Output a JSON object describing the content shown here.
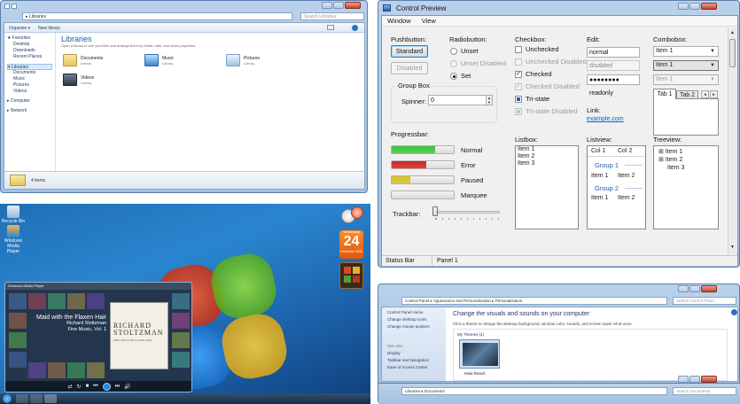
{
  "explorer": {
    "path": "Libraries",
    "search_placeholder": "Search Libraries",
    "toolbar": {
      "organize": "Organize ▾",
      "new_library": "New library"
    },
    "nav": {
      "favorites": "Favorites",
      "favorites_items": [
        "Desktop",
        "Downloads",
        "Recent Places"
      ],
      "libraries": "Libraries",
      "library_items": [
        "Documents",
        "Music",
        "Pictures",
        "Videos"
      ],
      "computer": "Computer",
      "network": "Network"
    },
    "header_title": "Libraries",
    "header_desc": "Open a library to see your files and arrange them by folder, date, and other properties.",
    "libraries": [
      {
        "name": "Documents",
        "type": "Library"
      },
      {
        "name": "Music",
        "type": "Library"
      },
      {
        "name": "Pictures",
        "type": "Library"
      },
      {
        "name": "Videos",
        "type": "Library"
      }
    ],
    "status": "4 items"
  },
  "desktop": {
    "icons": [
      "Recycle Bin",
      "Windows Media Player"
    ],
    "calendar": {
      "weekday": "Wednesday",
      "day": "24",
      "month": "December 2008"
    },
    "media_player": {
      "title": "Windows Media Player",
      "song": "Maid with the Flaxen Hair",
      "artist": "Richard Stoltzman",
      "album": "Fine Music, Vol. 1",
      "cover_title": "RICHARD STOLTZMAN",
      "cover_sub": "MAID WITH THE FLAXEN HAIR"
    }
  },
  "control_preview": {
    "title": "Control Preview",
    "menu": [
      "Window",
      "View"
    ],
    "pushbutton": {
      "label": "Pushbutton:",
      "standard": "Standard",
      "disabled": "Disabled"
    },
    "radiobutton": {
      "label": "Radiobutton:",
      "items": [
        "Unset",
        "Unset Disabled",
        "Set"
      ]
    },
    "checkbox": {
      "label": "Checkbox:",
      "items": [
        "Unchecked",
        "Unchecked Disabled",
        "Checked",
        "Checked Disabled",
        "Tri-state",
        "Tri-state Disabled"
      ]
    },
    "edit": {
      "label": "Edit:",
      "normal": "normal",
      "disabled": "disabled",
      "password": "●●●●●●●●",
      "readonly": "readonly"
    },
    "link": {
      "label": "Link:",
      "text": "example.com"
    },
    "combobox": {
      "label": "Combobox:",
      "items": [
        "Item 1",
        "Item 1",
        "Item 1"
      ]
    },
    "tabs": [
      "Tab 1",
      "Tab 2"
    ],
    "groupbox": {
      "label": "Group Box",
      "spinner_label": "Spinner:",
      "spinner_value": "0"
    },
    "progressbar": {
      "label": "Progressbar:",
      "bars": [
        {
          "name": "Normal",
          "value": 0.7,
          "color": "#3cc23c"
        },
        {
          "name": "Error",
          "value": 0.55,
          "color": "#d42020"
        },
        {
          "name": "Paused",
          "value": 0.3,
          "color": "#d6c21a"
        },
        {
          "name": "Marquee",
          "value": 0.0,
          "color": "#3cc23c"
        }
      ]
    },
    "trackbar": {
      "label": "Trackbar:",
      "value": 0
    },
    "listbox": {
      "label": "Listbox:",
      "items": [
        "Item 1",
        "Item 2",
        "Item 3"
      ]
    },
    "listview": {
      "label": "Listview:",
      "columns": [
        "Col 1",
        "Col 2"
      ],
      "groups": [
        {
          "name": "Group 1",
          "rows": [
            [
              "Item 1",
              "Item 2"
            ]
          ]
        },
        {
          "name": "Group 2",
          "rows": [
            [
              "Item 1",
              "Item 2"
            ]
          ]
        }
      ]
    },
    "treeview": {
      "label": "Treeview:",
      "items": [
        "Item 1",
        "Item 2",
        "Item 3"
      ]
    },
    "statusbar": {
      "left": "Status Bar",
      "right": "Panel 1"
    }
  },
  "personalization": {
    "path": "Control Panel ▸ Appearance and Personalization ▸ Personalization",
    "search_placeholder": "Search Control Panel",
    "left_links": [
      "Control Panel Home",
      "Change desktop icons",
      "Change mouse pointers"
    ],
    "see_also": "See also",
    "see_also_links": [
      "Display",
      "Taskbar and Navigation",
      "Ease of Access Center"
    ],
    "heading": "Change the visuals and sounds on your computer",
    "desc": "Click a theme to change the desktop background, window color, sounds, and screen saver all at once.",
    "my_themes": "My Themes (1)",
    "theme_name": "Halo Reach",
    "bottom_path": "Libraries ▸ Documents",
    "bottom_search": "Search Documents"
  }
}
